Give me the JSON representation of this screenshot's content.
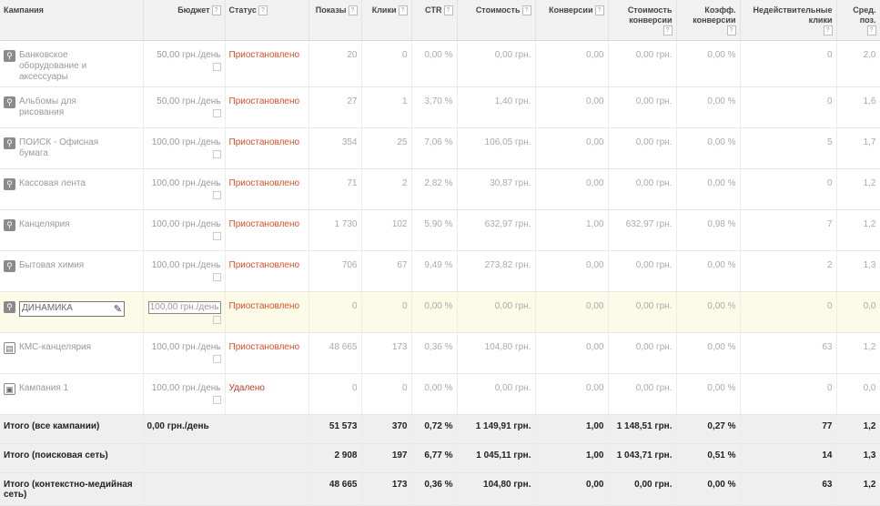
{
  "headers": [
    {
      "label": "Кампания",
      "help": false
    },
    {
      "label": "Бюджет",
      "help": true
    },
    {
      "label": "Статус",
      "help": true
    },
    {
      "label": "Показы",
      "help": true
    },
    {
      "label": "Клики",
      "help": true
    },
    {
      "label": "CTR",
      "help": true
    },
    {
      "label": "Стоимость",
      "help": true
    },
    {
      "label": "Конверсии",
      "help": true
    },
    {
      "label": "Стоимость конверсии",
      "help": true
    },
    {
      "label": "Коэфф. конверсии",
      "help": true
    },
    {
      "label": "Недействительные клики",
      "help": true
    },
    {
      "label": "Сред. поз.",
      "help": true
    }
  ],
  "help_glyph": "?",
  "campaigns": [
    {
      "icon": "search-icon",
      "name": "Банковское оборудование и аксессуары",
      "budget": "50,00 грн./день",
      "status": "Приостановлено",
      "impressions": "20",
      "clicks": "0",
      "ctr": "0,00 %",
      "cost": "0,00 грн.",
      "conversions": "0,00",
      "conv_cost": "0,00 грн.",
      "conv_rate": "0,00 %",
      "invalid": "0",
      "avg_pos": "2,0"
    },
    {
      "icon": "search-icon",
      "name": "Альбомы для рисования",
      "budget": "50,00 грн./день",
      "status": "Приостановлено",
      "impressions": "27",
      "clicks": "1",
      "ctr": "3,70 %",
      "cost": "1,40 грн.",
      "conversions": "0,00",
      "conv_cost": "0,00 грн.",
      "conv_rate": "0,00 %",
      "invalid": "0",
      "avg_pos": "1,6"
    },
    {
      "icon": "search-icon",
      "name": "ПОИСК - Офисная бумага",
      "budget": "100,00 грн./день",
      "status": "Приостановлено",
      "impressions": "354",
      "clicks": "25",
      "ctr": "7,06 %",
      "cost": "106,05 грн.",
      "conversions": "0,00",
      "conv_cost": "0,00 грн.",
      "conv_rate": "0,00 %",
      "invalid": "5",
      "avg_pos": "1,7"
    },
    {
      "icon": "search-icon",
      "name": "Кассовая лента",
      "budget": "100,00 грн./день",
      "status": "Приостановлено",
      "impressions": "71",
      "clicks": "2",
      "ctr": "2,82 %",
      "cost": "30,87 грн.",
      "conversions": "0,00",
      "conv_cost": "0,00 грн.",
      "conv_rate": "0,00 %",
      "invalid": "0",
      "avg_pos": "1,2"
    },
    {
      "icon": "search-icon",
      "name": "Канцелярия",
      "budget": "100,00 грн./день",
      "status": "Приостановлено",
      "impressions": "1 730",
      "clicks": "102",
      "ctr": "5,90 %",
      "cost": "632,97 грн.",
      "conversions": "1,00",
      "conv_cost": "632,97 грн.",
      "conv_rate": "0,98 %",
      "invalid": "7",
      "avg_pos": "1,2"
    },
    {
      "icon": "search-icon",
      "name": "Бытовая химия",
      "budget": "100,00 грн./день",
      "status": "Приостановлено",
      "impressions": "706",
      "clicks": "67",
      "ctr": "9,49 %",
      "cost": "273,82 грн.",
      "conversions": "0,00",
      "conv_cost": "0,00 грн.",
      "conv_rate": "0,00 %",
      "invalid": "2",
      "avg_pos": "1,3"
    },
    {
      "icon": "search-icon",
      "name": "ДИНАМИКА",
      "budget": "100,00 грн./день",
      "status": "Приостановлено",
      "impressions": "0",
      "clicks": "0",
      "ctr": "0,00 %",
      "cost": "0,00 грн.",
      "conversions": "0,00",
      "conv_cost": "0,00 грн.",
      "conv_rate": "0,00 %",
      "invalid": "0",
      "avg_pos": "0,0",
      "highlighted": true
    },
    {
      "icon": "display-network-icon",
      "name": "КМС-канцелярия",
      "budget": "100,00 грн./день",
      "status": "Приостановлено",
      "impressions": "48 665",
      "clicks": "173",
      "ctr": "0,36 %",
      "cost": "104,80 грн.",
      "conversions": "0,00",
      "conv_cost": "0,00 грн.",
      "conv_rate": "0,00 %",
      "invalid": "63",
      "avg_pos": "1,2"
    },
    {
      "icon": "campaign-icon",
      "name": "Кампания 1",
      "budget": "100,00 грн./день",
      "status": "Удалено",
      "impressions": "0",
      "clicks": "0",
      "ctr": "0,00 %",
      "cost": "0,00 грн.",
      "conversions": "0,00",
      "conv_cost": "0,00 грн.",
      "conv_rate": "0,00 %",
      "invalid": "0",
      "avg_pos": "0,0",
      "deleted": true
    }
  ],
  "totals": [
    {
      "label": "Итого (все кампании)",
      "budget": "0,00 грн./день",
      "impressions": "51 573",
      "clicks": "370",
      "ctr": "0,72 %",
      "cost": "1 149,91 грн.",
      "conversions": "1,00",
      "conv_cost": "1 148,51 грн.",
      "conv_rate": "0,27 %",
      "invalid": "77",
      "avg_pos": "1,2"
    },
    {
      "label": "Итого (поисковая сеть)",
      "budget": "",
      "impressions": "2 908",
      "clicks": "197",
      "ctr": "6,77 %",
      "cost": "1 045,11 грн.",
      "conversions": "1,00",
      "conv_cost": "1 043,71 грн.",
      "conv_rate": "0,51 %",
      "invalid": "14",
      "avg_pos": "1,3"
    },
    {
      "label": "Итого (контекстно-медийная сеть)",
      "budget": "",
      "impressions": "48 665",
      "clicks": "173",
      "ctr": "0,36 %",
      "cost": "104,80 грн.",
      "conversions": "0,00",
      "conv_cost": "0,00 грн.",
      "conv_rate": "0,00 %",
      "invalid": "63",
      "avg_pos": "1,2"
    }
  ],
  "edit_icon": "pencil-icon"
}
